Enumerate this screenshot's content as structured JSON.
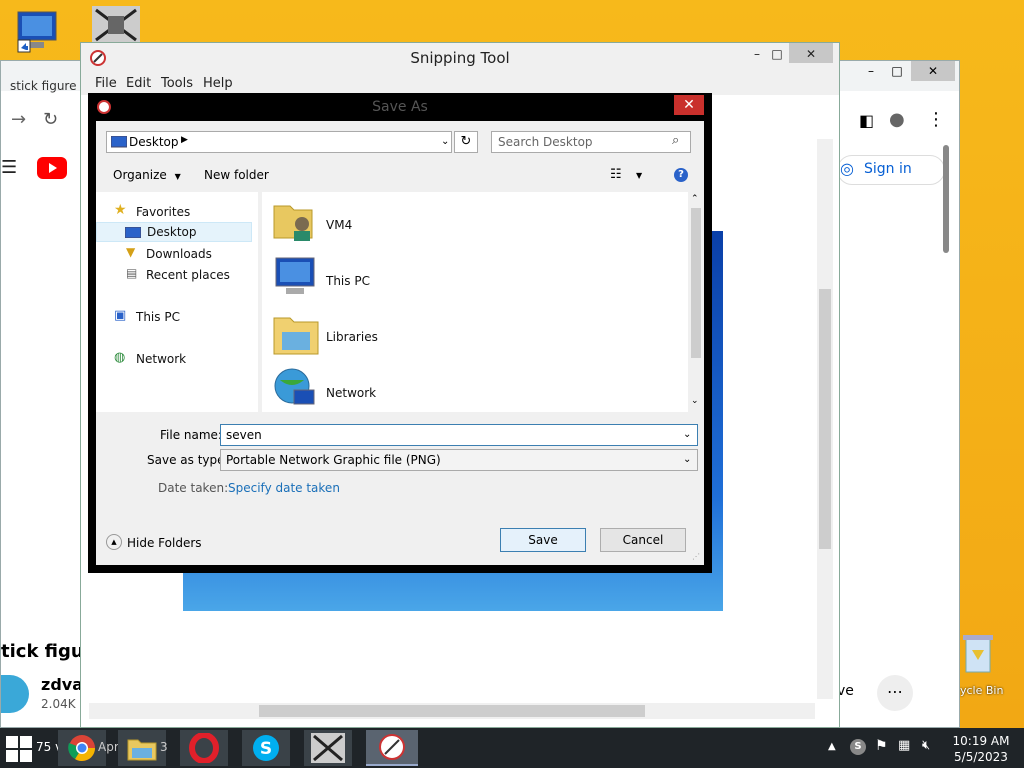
{
  "chrome": {
    "tab_text": "stick figure w",
    "signin": "Sign in",
    "video_title": "tick figure",
    "channel": "zdval",
    "subs": "2.04K s",
    "right_text": "ve",
    "more": "⋯"
  },
  "snipping_tool": {
    "title": "Snipping Tool",
    "menu": [
      "File",
      "Edit",
      "Tools",
      "Help"
    ],
    "minimize": "–",
    "maximize": "□",
    "close": "✕"
  },
  "dialog": {
    "title": "Save As",
    "address": "Desktop",
    "search_placeholder": "Search Desktop",
    "organize": "Organize",
    "new_folder": "New folder",
    "nav": {
      "favorites": "Favorites",
      "desktop": "Desktop",
      "downloads": "Downloads",
      "recent": "Recent places",
      "this_pc": "This PC",
      "network": "Network"
    },
    "files": [
      "VM4",
      "This PC",
      "Libraries",
      "Network"
    ],
    "file_name_label": "File name:",
    "file_name_value": "seven",
    "save_type_label": "Save as type:",
    "save_type_value": "Portable Network Graphic file (PNG)",
    "date_label": "Date taken:",
    "date_link": "Specify date taken",
    "hide_folders": "Hide Folders",
    "save": "Save",
    "cancel": "Cancel"
  },
  "desktop": {
    "recycle_bin": "ycle Bin"
  },
  "taskbar": {
    "search_text": "75 vi",
    "date_text": "Apr 6",
    "num": "3",
    "time": "10:19 AM",
    "date": "5/5/2023"
  }
}
